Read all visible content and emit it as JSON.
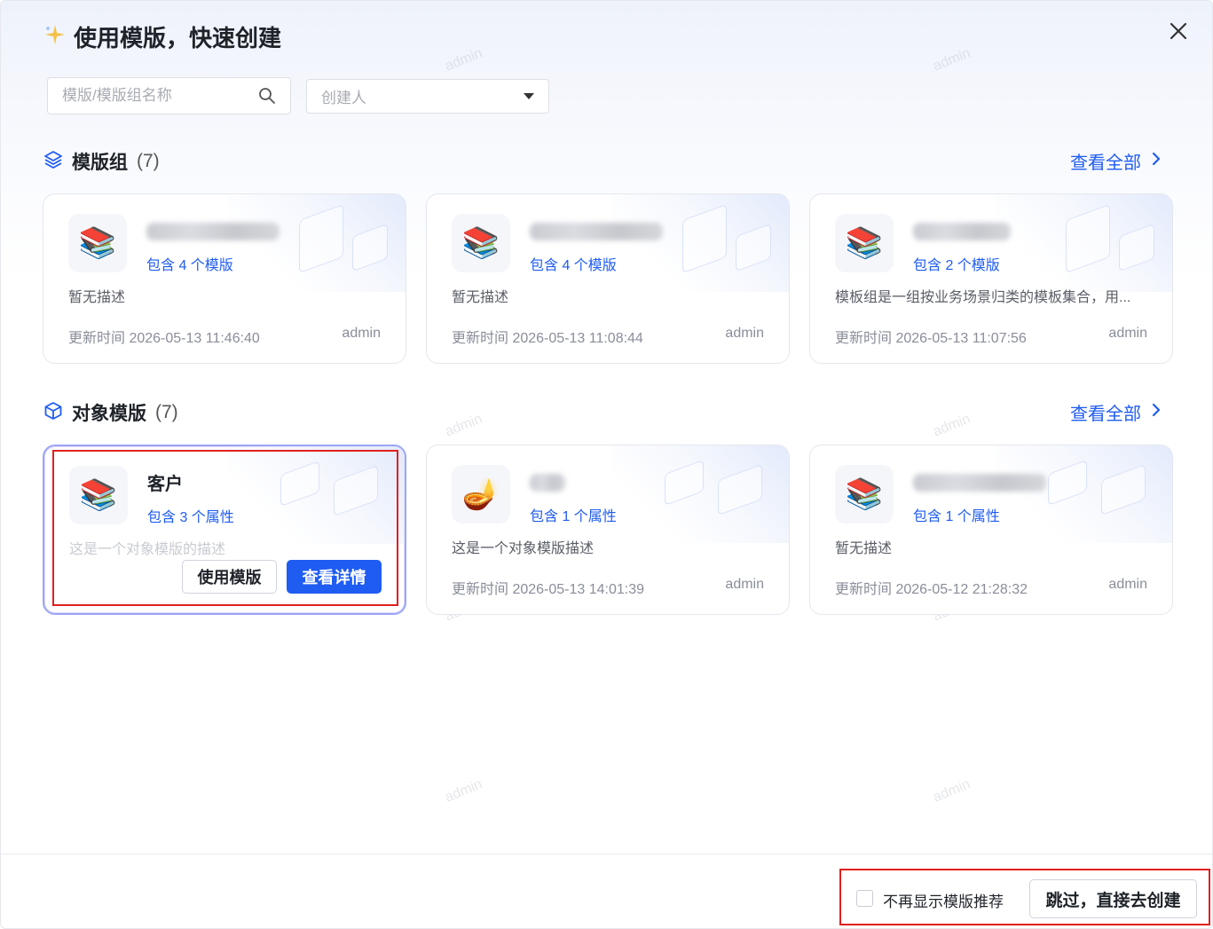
{
  "dialog": {
    "title": "使用模版，快速创建"
  },
  "filters": {
    "search_placeholder": "模版/模版组名称",
    "creator_placeholder": "创建人"
  },
  "template_groups": {
    "title": "模版组",
    "count": "(7)",
    "view_all": "查看全部",
    "cards": [
      {
        "meta": "包含 4 个模版",
        "desc": "暂无描述",
        "updated": "更新时间 2026-05-13 11:46:40",
        "author": "admin"
      },
      {
        "meta": "包含 4 个模版",
        "desc": "暂无描述",
        "updated": "更新时间 2026-05-13 11:08:44",
        "author": "admin"
      },
      {
        "meta": "包含 2 个模版",
        "desc": "模板组是一组按业务场景归类的模板集合，用...",
        "updated": "更新时间 2026-05-13 11:07:56",
        "author": "admin"
      }
    ]
  },
  "object_templates": {
    "title": "对象模版",
    "count": "(7)",
    "view_all": "查看全部",
    "cards": [
      {
        "name": "客户",
        "meta": "包含 3 个属性",
        "desc": "这是一个对象模版的描述",
        "use_button": "使用模版",
        "detail_button": "查看详情"
      },
      {
        "meta": "包含 1 个属性",
        "desc": "这是一个对象模版描述",
        "updated": "更新时间 2026-05-13 14:01:39",
        "author": "admin"
      },
      {
        "meta": "包含 1 个属性",
        "desc": "暂无描述",
        "updated": "更新时间 2026-05-12 21:28:32",
        "author": "admin"
      }
    ]
  },
  "footer": {
    "checkbox_label": "不再显示模版推荐",
    "skip_button": "跳过，直接去创建"
  },
  "watermark": "admin",
  "icons": {
    "title": "sparkle-icon",
    "close": "close-icon",
    "search": "search-icon",
    "groups": "layers-icon",
    "objects": "cube-icon",
    "book": "books-icon",
    "bowl": "bowl-icon"
  },
  "colors": {
    "accent": "#1f5cf2",
    "highlight": "#e0201f"
  }
}
